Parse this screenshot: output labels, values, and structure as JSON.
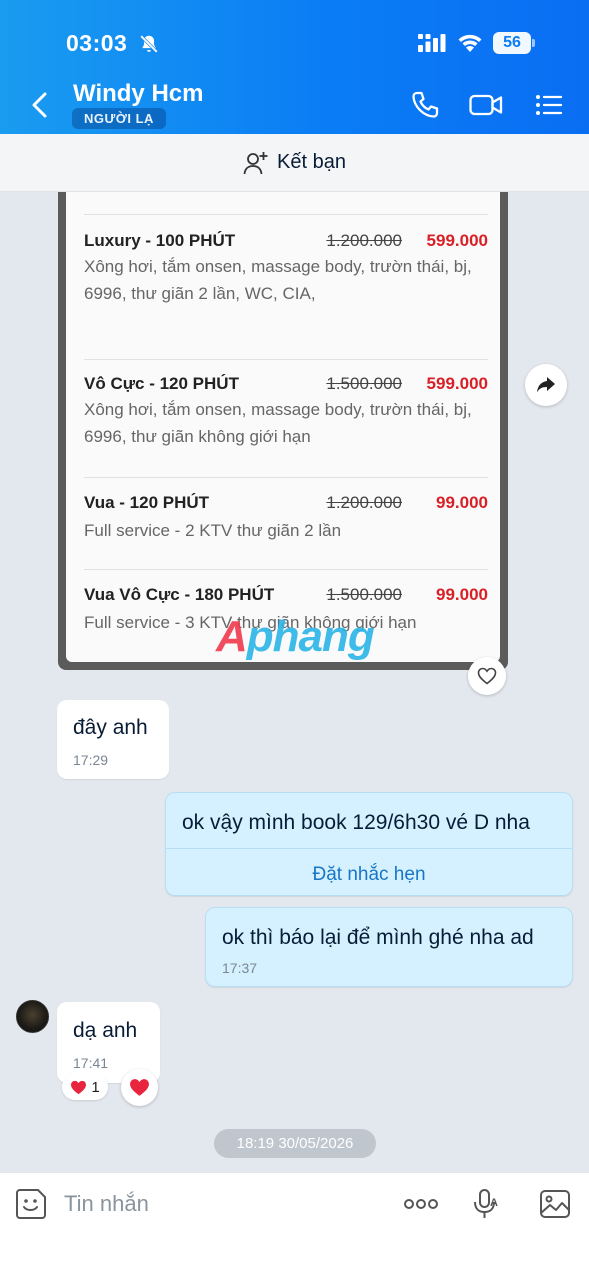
{
  "status_bar": {
    "time": "03:03",
    "battery": "56"
  },
  "header": {
    "contact_name": "Windy Hcm",
    "badge": "NGƯỜI LẠ"
  },
  "friend_bar": {
    "label": "Kết bạn"
  },
  "shared_image": {
    "items": [
      {
        "title": "Luxury - 100 PHÚT",
        "old_price": "1.200.000",
        "new_price": "599.000",
        "desc": "Xông hơi, tắm onsen, massage body, trườn thái, bj, 6996, thư giãn 2 lần, WC, CIA,"
      },
      {
        "title": "Vô Cực - 120 PHÚT",
        "old_price": "1.500.000",
        "new_price": "599.000",
        "desc": "Xông hơi, tắm onsen, massage body, trườn thái, bj, 6996, thư giãn không giới hạn"
      },
      {
        "title": "Vua - 120 PHÚT",
        "old_price": "1.200.000",
        "new_price": "99.000",
        "desc": "Full service - 2 KTV thư giãn 2 lần"
      },
      {
        "title": "Vua Vô Cực - 180 PHÚT",
        "old_price": "1.500.000",
        "new_price": "99.000",
        "desc": "Full service - 3 KTV thư giãn không giới hạn"
      }
    ],
    "watermark_a": "A",
    "watermark_rest": "phang"
  },
  "messages": [
    {
      "from": "them",
      "text": "đây anh",
      "time": "17:29"
    },
    {
      "from": "me",
      "text": "ok vậy mình book 129/6h30 vé D nha",
      "action": "Đặt nhắc hẹn"
    },
    {
      "from": "me",
      "text": "ok thì báo lại để mình ghé nha ad",
      "time": "17:37"
    },
    {
      "from": "them",
      "text": "dạ anh",
      "time": "17:41",
      "reaction_count": "1"
    }
  ],
  "date_separator": "18:19 30/05/2026",
  "input": {
    "placeholder": "Tin nhắn"
  },
  "colors": {
    "header_start": "#1a9cf0",
    "header_end": "#0a6ef3",
    "outgoing_bubble": "#d5f1ff",
    "price_red": "#d92026",
    "link_blue": "#1876c7"
  }
}
